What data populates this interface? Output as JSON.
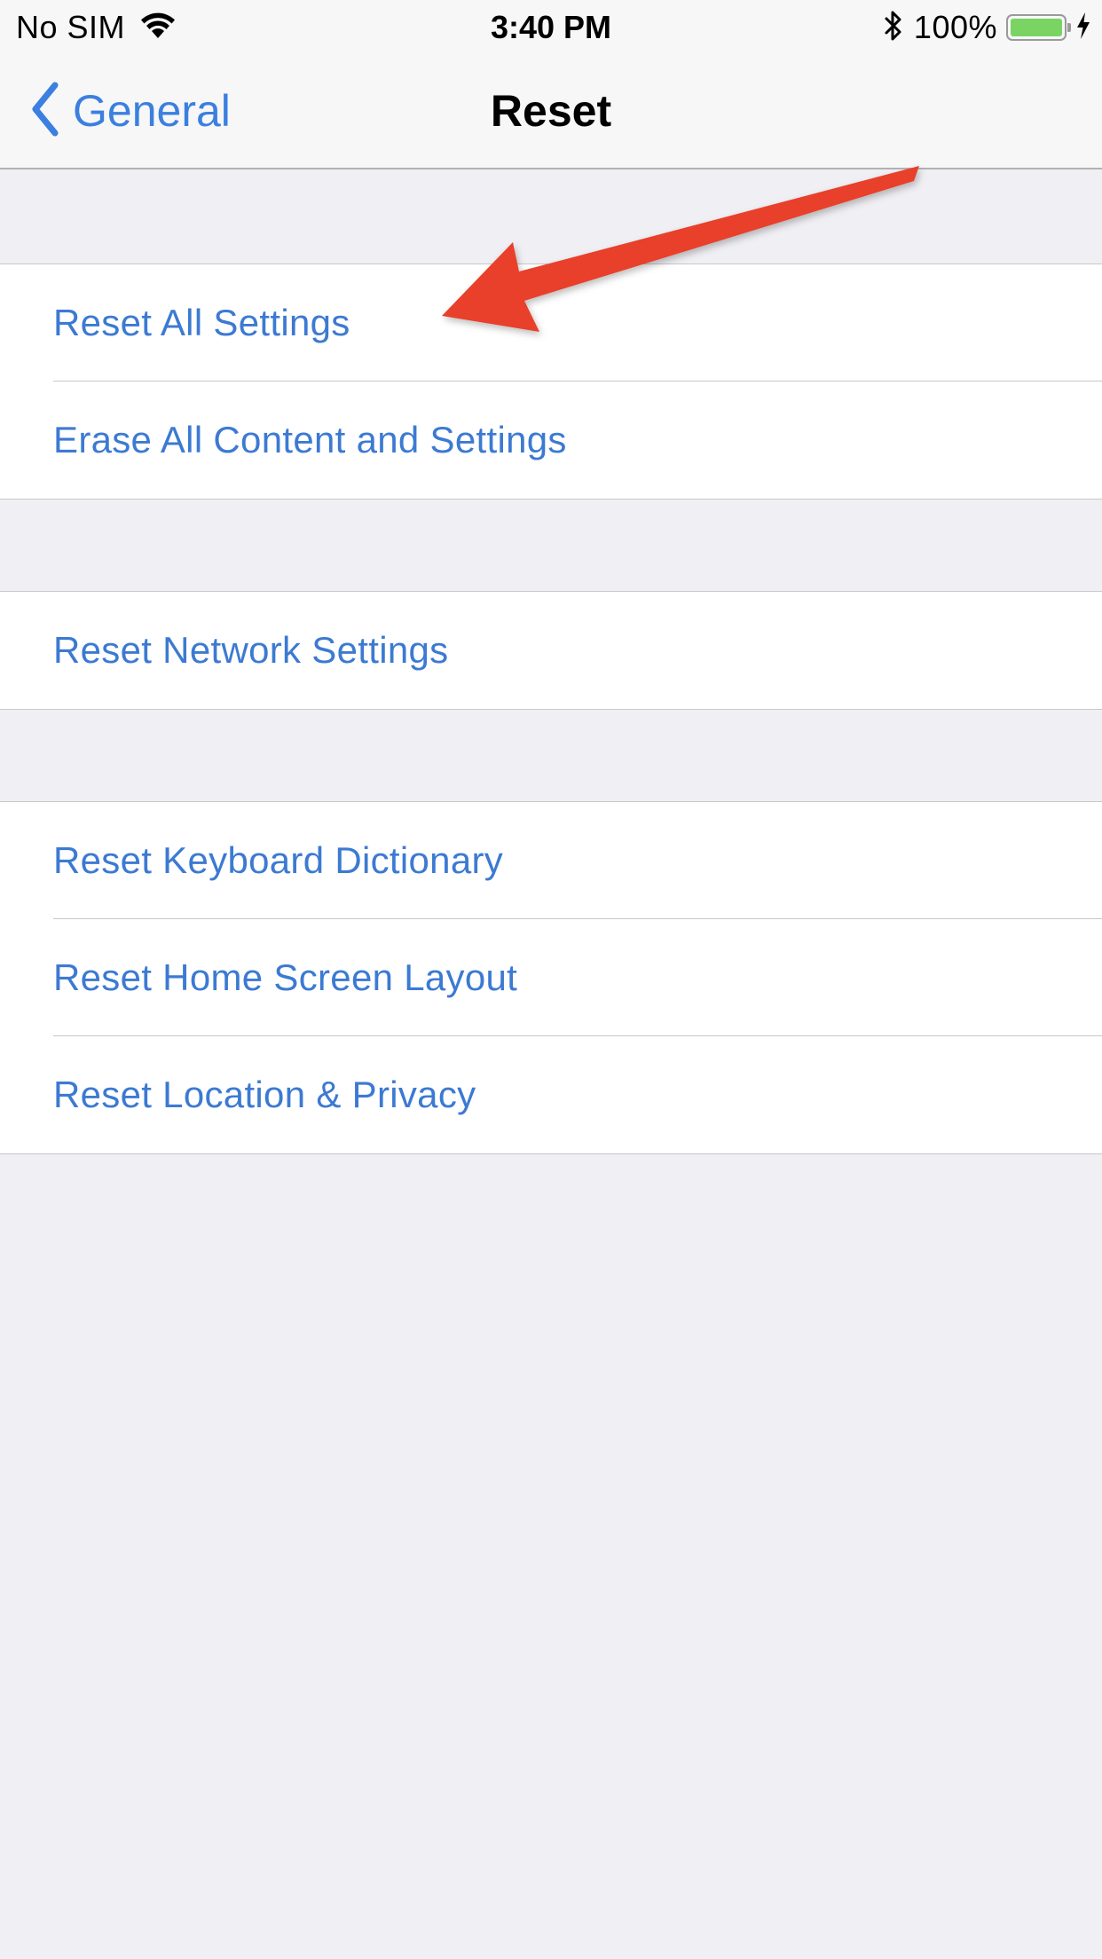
{
  "status_bar": {
    "carrier": "No SIM",
    "time": "3:40 PM",
    "battery": "100%",
    "battery_level": 1.0,
    "icons": [
      "wifi-icon",
      "bluetooth-icon",
      "battery-icon",
      "charging-bolt-icon"
    ]
  },
  "nav": {
    "back_label": "General",
    "title": "Reset",
    "back_icon": "chevron-left-icon"
  },
  "groups": [
    {
      "rows": [
        {
          "label": "Reset All Settings"
        },
        {
          "label": "Erase All Content and Settings"
        }
      ]
    },
    {
      "rows": [
        {
          "label": "Reset Network Settings"
        }
      ]
    },
    {
      "rows": [
        {
          "label": "Reset Keyboard Dictionary"
        },
        {
          "label": "Reset Home Screen Layout"
        },
        {
          "label": "Reset Location & Privacy"
        }
      ]
    }
  ],
  "colors": {
    "accent": "#3b7fe0",
    "row_text": "#3c7ad2",
    "background": "#efeff4",
    "annotation_arrow": "#e8412a"
  }
}
